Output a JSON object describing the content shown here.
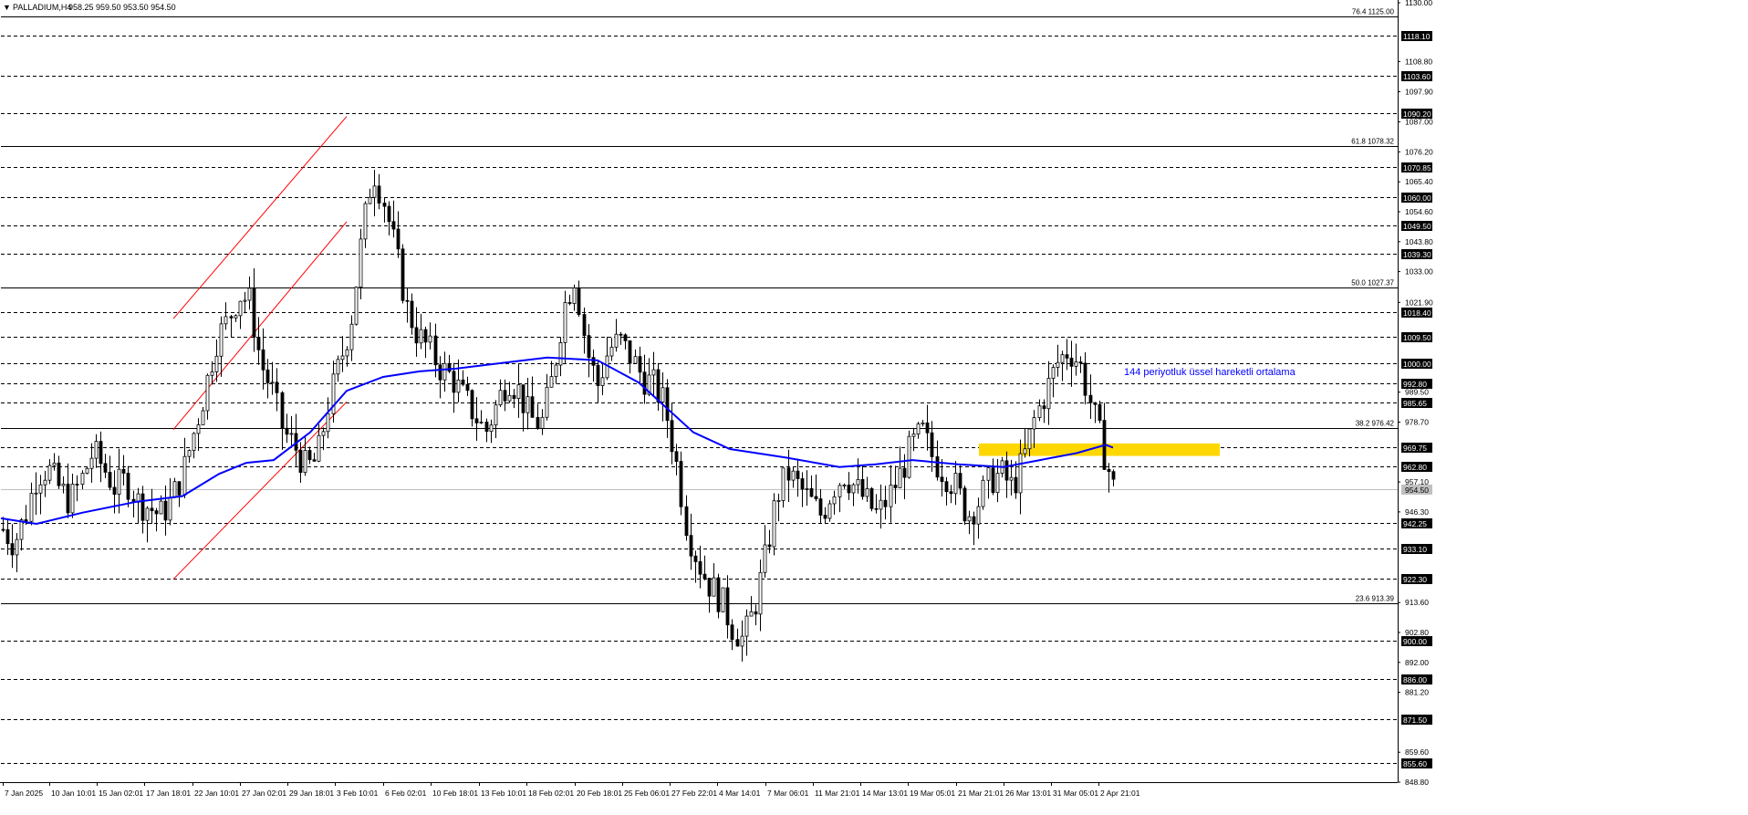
{
  "window": {
    "title": "PALLADIUM,H4",
    "ohlc": "958.25 959.50 953.50 954.50",
    "collapse_glyph": "▼"
  },
  "colors": {
    "background": "#ffffff",
    "candle": "#000000",
    "ema": "#0000ff",
    "channel": "#ff0000",
    "zone": "#ffd700",
    "annotation": "#0000ff",
    "level_line": "#000000"
  },
  "chart_data": {
    "type": "candlestick",
    "symbol": "PALLADIUM",
    "timeframe": "H4",
    "ylim": [
      848.8,
      1130.0
    ],
    "y_tick_labels": [
      {
        "value": 1130.0,
        "label": "1130.00"
      },
      {
        "value": 1108.8,
        "label": "1108.80"
      },
      {
        "value": 1097.9,
        "label": "1097.90"
      },
      {
        "value": 1087.0,
        "label": "1087.00"
      },
      {
        "value": 1076.2,
        "label": "1076.20"
      },
      {
        "value": 1065.4,
        "label": "1065.40"
      },
      {
        "value": 1054.6,
        "label": "1054.60"
      },
      {
        "value": 1043.8,
        "label": "1043.80"
      },
      {
        "value": 1033.0,
        "label": "1033.00"
      },
      {
        "value": 1021.9,
        "label": "1021.90"
      },
      {
        "value": 989.5,
        "label": "989.50"
      },
      {
        "value": 978.7,
        "label": "978.70"
      },
      {
        "value": 967.9,
        "label": "967.90"
      },
      {
        "value": 957.1,
        "label": "957.10"
      },
      {
        "value": 946.3,
        "label": "946.30"
      },
      {
        "value": 935.3,
        "label": "935.30"
      },
      {
        "value": 924.5,
        "label": "924.50"
      },
      {
        "value": 913.6,
        "label": "913.60"
      },
      {
        "value": 902.8,
        "label": "902.80"
      },
      {
        "value": 892.0,
        "label": "892.00"
      },
      {
        "value": 881.2,
        "label": "881.20"
      },
      {
        "value": 870.4,
        "label": "870.40"
      },
      {
        "value": 859.6,
        "label": "859.60"
      },
      {
        "value": 848.8,
        "label": "848.80"
      }
    ],
    "horizontal_levels": [
      1118.1,
      1103.6,
      1090.2,
      1070.85,
      1060.0,
      1049.5,
      1039.3,
      1018.4,
      1009.5,
      1000.0,
      992.8,
      985.65,
      969.75,
      962.8,
      942.25,
      933.1,
      922.3,
      900.0,
      886.0,
      871.5,
      855.6
    ],
    "level_labels": [
      "1118.10",
      "1103.60",
      "1090.20",
      "1070.85",
      "1060.00",
      "1049.50",
      "1039.30",
      "1018.40",
      "1009.50",
      "1000.00",
      "992.80",
      "985.65",
      "969.75",
      "962.80",
      "942.25",
      "933.10",
      "922.30",
      "900.00",
      "886.00",
      "871.50",
      "855.60"
    ],
    "current_price": {
      "value": 954.5,
      "label": "954.50"
    },
    "fibonacci": [
      {
        "value": 1125.0,
        "label": "76.4 1125.00"
      },
      {
        "value": 1078.32,
        "label": "61.8 1078.32"
      },
      {
        "value": 1027.37,
        "label": "50.0 1027.37"
      },
      {
        "value": 976.42,
        "label": "38.2 976.42"
      },
      {
        "value": 913.39,
        "label": "23.6 913.39"
      }
    ],
    "x_tick_labels": [
      "7 Jan 2025",
      "10 Jan 10:01",
      "15 Jan 02:01",
      "17 Jan 18:01",
      "22 Jan 10:01",
      "27 Jan 02:01",
      "29 Jan 18:01",
      "3 Feb 10:01",
      "6 Feb 02:01",
      "10 Feb 18:01",
      "13 Feb 10:01",
      "18 Feb 02:01",
      "20 Feb 18:01",
      "25 Feb 06:01",
      "27 Feb 22:01",
      "4 Mar 14:01",
      "7 Mar 06:01",
      "11 Mar 21:01",
      "14 Mar 13:01",
      "19 Mar 05:01",
      "21 Mar 21:01",
      "26 Mar 13:01",
      "31 Mar 05:01",
      "2 Apr 21:01"
    ],
    "price_path": [
      940,
      935,
      945,
      960,
      962,
      955,
      950,
      958,
      968,
      962,
      955,
      958,
      950,
      948,
      945,
      950,
      960,
      975,
      990,
      1008,
      1015,
      1025,
      1022,
      1000,
      990,
      975,
      970,
      962,
      965,
      985,
      1000,
      1015,
      1045,
      1070,
      1058,
      1040,
      1020,
      1010,
      1005,
      998,
      995,
      988,
      982,
      975,
      985,
      995,
      990,
      980,
      978,
      995,
      1020,
      1032,
      1005,
      992,
      1005,
      1008,
      1002,
      995,
      992,
      985,
      965,
      940,
      928,
      920,
      915,
      905,
      900,
      912,
      930,
      952,
      960,
      955,
      950,
      945,
      955,
      960,
      955,
      950,
      945,
      952,
      960,
      970,
      975,
      965,
      960,
      955,
      945,
      950,
      958,
      960,
      955,
      965,
      980,
      990,
      1000,
      1005,
      1000,
      985,
      970,
      955
    ],
    "ema_period": 144,
    "ema_path": [
      [
        1,
        944.0
      ],
      [
        40,
        942.0
      ],
      [
        90,
        946.0
      ],
      [
        150,
        950.0
      ],
      [
        200,
        952.0
      ],
      [
        240,
        960.0
      ],
      [
        270,
        964.0
      ],
      [
        300,
        965.0
      ],
      [
        340,
        975.0
      ],
      [
        380,
        990.0
      ],
      [
        420,
        995.0
      ],
      [
        460,
        997.0
      ],
      [
        500,
        998.0
      ],
      [
        550,
        1000.0
      ],
      [
        600,
        1002.0
      ],
      [
        655,
        1001.0
      ],
      [
        700,
        993.0
      ],
      [
        760,
        975.0
      ],
      [
        800,
        969.0
      ],
      [
        860,
        966.0
      ],
      [
        920,
        962.5
      ],
      [
        960,
        963.5
      ],
      [
        1000,
        965.0
      ],
      [
        1050,
        963.5
      ],
      [
        1100,
        962.5
      ],
      [
        1140,
        965.0
      ],
      [
        1180,
        967.5
      ],
      [
        1212,
        970.5
      ],
      [
        1220,
        969.5
      ]
    ],
    "channel_lines": [
      [
        [
          190,
          1016.0
        ],
        [
          380,
          1089.0
        ]
      ],
      [
        [
          190,
          976.0
        ],
        [
          380,
          1051.0
        ]
      ],
      [
        [
          190,
          922.0
        ],
        [
          380,
          986.0
        ]
      ]
    ],
    "zone": {
      "x_from": 1073,
      "x_to": 1337,
      "y_from": 966.5,
      "y_to": 971.0
    },
    "annotation": "144 periyotluk üssel hareketli ortalama",
    "n_candles": 240,
    "candle_x_start": 3,
    "candle_x_end": 1220
  }
}
